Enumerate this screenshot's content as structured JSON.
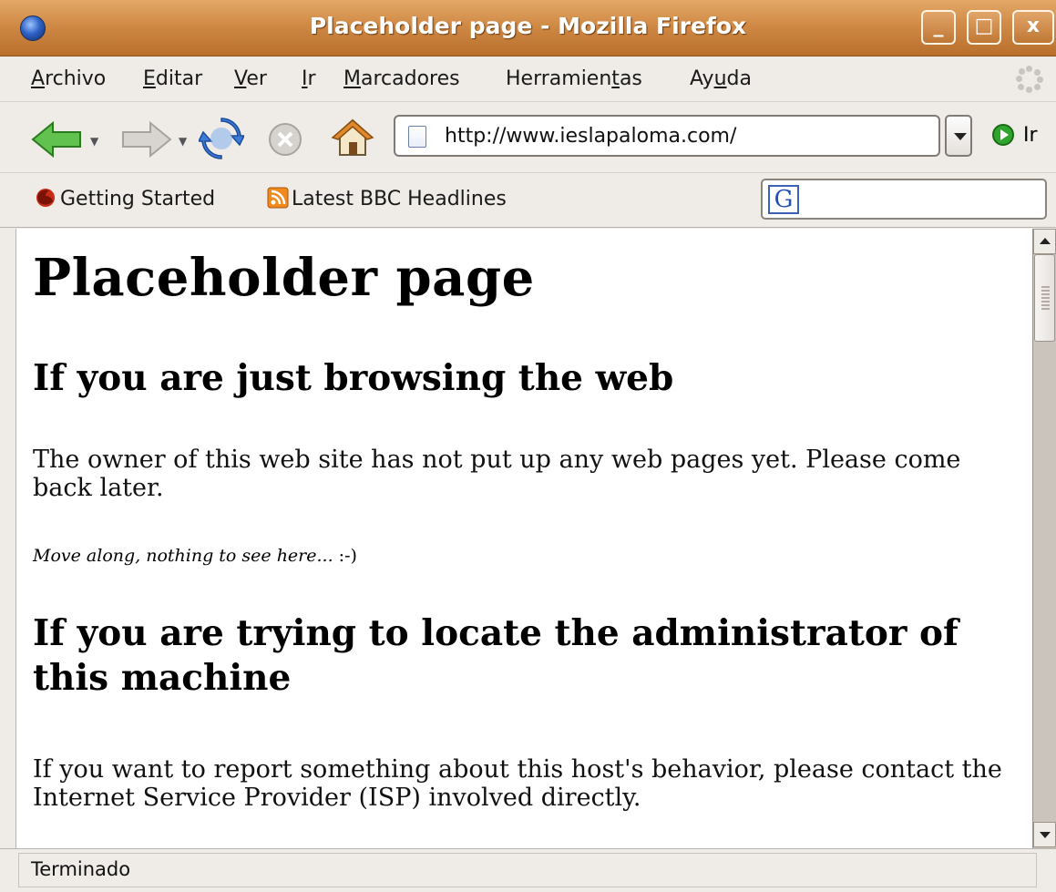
{
  "window": {
    "title": "Placeholder page - Mozilla Firefox",
    "buttons": {
      "minimize": "_",
      "maximize": "□",
      "close": "x"
    }
  },
  "menu": {
    "items": [
      {
        "pre": "",
        "key": "A",
        "post": "rchivo"
      },
      {
        "pre": "",
        "key": "E",
        "post": "ditar"
      },
      {
        "pre": "",
        "key": "V",
        "post": "er"
      },
      {
        "pre": "",
        "key": "I",
        "post": "r"
      },
      {
        "pre": "",
        "key": "M",
        "post": "arcadores"
      },
      {
        "pre": "Herramien",
        "key": "t",
        "post": "as"
      },
      {
        "pre": "Ay",
        "key": "u",
        "post": "da"
      }
    ]
  },
  "navigation": {
    "url": "http://www.ieslapaloma.com/",
    "go_label": "Ir",
    "icons": [
      "back-arrow-icon",
      "forward-arrow-icon",
      "reload-icon",
      "stop-icon",
      "home-icon"
    ]
  },
  "bookmarks": {
    "items": [
      {
        "label": "Getting Started",
        "icon": "firefox-icon"
      },
      {
        "label": "Latest BBC Headlines",
        "icon": "rss-icon"
      }
    ],
    "search_engine_icon": "G"
  },
  "page": {
    "h1": "Placeholder page",
    "section1_heading": "If you are just browsing the web",
    "section1_p1": "The owner of this web site has not put up any web pages yet. Please come back later.",
    "section1_small_italic": "Move along, nothing to see here...",
    "section1_small_plain": " :-)",
    "section2_heading": "If you are trying to locate the administrator of this machine",
    "section2_p1": "If you want to report something about this host's behavior, please contact the Internet Service Provider (ISP) involved directly."
  },
  "status": {
    "text": "Terminado"
  },
  "colors": {
    "titlebar": "#d08a45",
    "chrome": "#efebe7",
    "go_green": "#2fa52b",
    "back_green": "#4cae3b"
  }
}
